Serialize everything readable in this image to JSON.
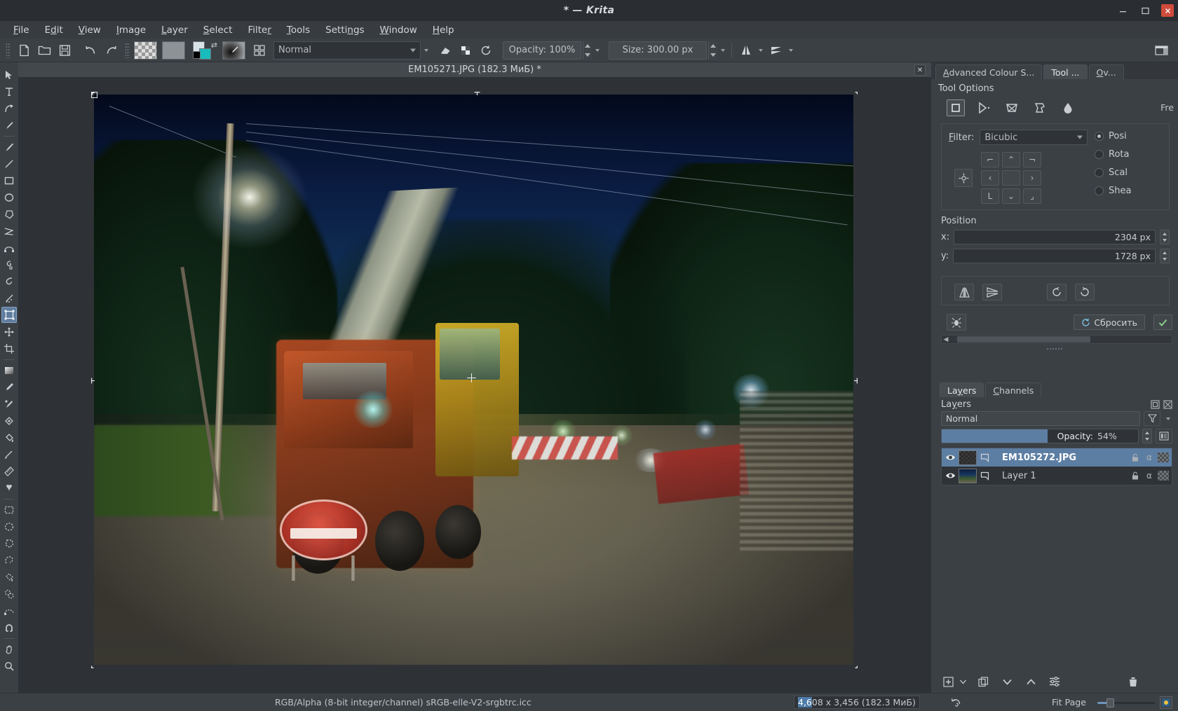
{
  "window": {
    "title": "* — Krita",
    "controls": {
      "minimize": "–",
      "maximize": "□",
      "close": "✕"
    }
  },
  "menubar": {
    "items": [
      {
        "label": "File",
        "accel": "F"
      },
      {
        "label": "Edit",
        "accel": "E"
      },
      {
        "label": "View",
        "accel": "V"
      },
      {
        "label": "Image",
        "accel": "I"
      },
      {
        "label": "Layer",
        "accel": "L"
      },
      {
        "label": "Select",
        "accel": "S"
      },
      {
        "label": "Filter",
        "accel": "r"
      },
      {
        "label": "Tools",
        "accel": "T"
      },
      {
        "label": "Settings",
        "accel": "n"
      },
      {
        "label": "Window",
        "accel": "W"
      },
      {
        "label": "Help",
        "accel": "H"
      }
    ]
  },
  "toolbar": {
    "new_label": "new-document",
    "open_label": "open-document",
    "save_label": "save-document",
    "undo_label": "undo",
    "redo_label": "redo",
    "gradient_label": "gradients",
    "pattern_label": "patterns",
    "fgbg_label": "foreground-background-colours",
    "brush_preset_label": "brush-presets",
    "brush_editor_label": "edit-brush-settings",
    "blending_mode": "Normal",
    "eraser_label": "eraser-mode",
    "alpha_label": "preserve-alpha",
    "reload_label": "reload-preset",
    "opacity": "Opacity: 100%",
    "size": "Size: 300.00 px",
    "mirror_h_label": "horizontal-mirror",
    "mirror_v_label": "vertical-mirror",
    "workspace_label": "choose-workspace"
  },
  "toolbox": {
    "tools": [
      {
        "name": "select-shapes-tool",
        "glyph": "cursor",
        "active": false
      },
      {
        "name": "text-tool",
        "glyph": "text",
        "active": false
      },
      {
        "name": "edit-shapes-tool",
        "glyph": "node",
        "active": false
      },
      {
        "name": "calligraphy-tool",
        "glyph": "calligraphy",
        "active": false
      },
      {
        "name": "freehand-brush-tool",
        "glyph": "brush",
        "active": false
      },
      {
        "name": "line-tool",
        "glyph": "line",
        "active": false
      },
      {
        "name": "rectangle-tool",
        "glyph": "rect",
        "active": false
      },
      {
        "name": "ellipse-tool",
        "glyph": "ellipse",
        "active": false
      },
      {
        "name": "polygon-tool",
        "glyph": "polygon",
        "active": false
      },
      {
        "name": "polyline-tool",
        "glyph": "polyline",
        "active": false
      },
      {
        "name": "bezier-curve-tool",
        "glyph": "bezier",
        "active": false
      },
      {
        "name": "freehand-path-tool",
        "glyph": "freehandpath",
        "active": false
      },
      {
        "name": "dynamic-brush-tool",
        "glyph": "dynbrush",
        "active": false
      },
      {
        "name": "multibrush-tool",
        "glyph": "multibrush",
        "active": false
      },
      {
        "name": "transform-tool",
        "glyph": "transform",
        "active": true
      },
      {
        "name": "move-tool",
        "glyph": "move",
        "active": false
      },
      {
        "name": "crop-tool",
        "glyph": "crop",
        "active": false
      },
      {
        "name": "gradient-tool",
        "glyph": "gradient",
        "active": false
      },
      {
        "name": "colour-sampler-tool",
        "glyph": "picker",
        "active": false
      },
      {
        "name": "colourize-mask-tool",
        "glyph": "colorize",
        "active": false
      },
      {
        "name": "smart-patch-tool",
        "glyph": "patch",
        "active": false
      },
      {
        "name": "fill-tool",
        "glyph": "fill",
        "active": false
      },
      {
        "name": "enclose-and-fill-tool",
        "glyph": "enclosefill",
        "active": false
      },
      {
        "name": "measure-tool",
        "glyph": "measure",
        "active": false
      },
      {
        "name": "reference-images-tool",
        "glyph": "reference",
        "active": false
      },
      {
        "name": "rectangular-selection-tool",
        "glyph": "selrect",
        "active": false
      },
      {
        "name": "elliptical-selection-tool",
        "glyph": "selellipse",
        "active": false
      },
      {
        "name": "polygonal-selection-tool",
        "glyph": "selpoly",
        "active": false
      },
      {
        "name": "freehand-selection-tool",
        "glyph": "sellasso",
        "active": false
      },
      {
        "name": "contiguous-selection-tool",
        "glyph": "selcontig",
        "active": false
      },
      {
        "name": "similar-colour-selection-tool",
        "glyph": "selsimilar",
        "active": false
      },
      {
        "name": "bezier-selection-tool",
        "glyph": "selbezier",
        "active": false
      },
      {
        "name": "magnetic-selection-tool",
        "glyph": "selmagnetic",
        "active": false
      },
      {
        "name": "pan-tool",
        "glyph": "pan",
        "active": false
      },
      {
        "name": "zoom-tool",
        "glyph": "zoom",
        "active": false
      }
    ]
  },
  "document": {
    "tab_title": "EM105271.JPG (182.3 МиБ) *",
    "close_label": "✕"
  },
  "right_dock": {
    "tabs": [
      {
        "label": "Advanced Colour S...",
        "accel": "A",
        "active": false
      },
      {
        "label": "Tool ...",
        "accel": "",
        "active": true
      },
      {
        "label": "Ov...",
        "accel": "O",
        "active": false
      }
    ],
    "tool_options": {
      "title": "Tool Options",
      "modes": [
        {
          "name": "free-transform-mode",
          "active": true
        },
        {
          "name": "perspective-transform-mode",
          "active": false
        },
        {
          "name": "warp-transform-mode",
          "active": false
        },
        {
          "name": "cage-transform-mode",
          "active": false
        },
        {
          "name": "liquify-transform-mode",
          "active": false
        }
      ],
      "mode_name": "Fre",
      "filter_label": "Filter:",
      "filter_value": "Bicubic",
      "anchor_label": "anchor-point-selector",
      "position_label": "Position",
      "x_label": "x:",
      "x_value": "2304 px",
      "y_label": "y:",
      "y_value": "1728 px",
      "radios": [
        {
          "label": "Posi",
          "on": true
        },
        {
          "label": "Rota",
          "on": false
        },
        {
          "label": "Scal",
          "on": false
        },
        {
          "label": "Shea",
          "on": false
        }
      ],
      "flip_h_label": "flip-horizontally",
      "flip_v_label": "flip-vertically",
      "rotate_ccw_label": "rotate-counter-clockwise",
      "rotate_cw_label": "rotate-clockwise",
      "bug_label": "recursive-transform",
      "reset_label": "Сбросить",
      "apply_label": "✓"
    },
    "layers_docker": {
      "tabs": [
        {
          "label": "Layers",
          "accel": "y",
          "active": true
        },
        {
          "label": "Channels",
          "accel": "C",
          "active": false
        }
      ],
      "title": "Layers",
      "float_label": "float-docker",
      "close_label": "close-docker",
      "blending_mode": "Normal",
      "filter_label": "layer-filter",
      "opacity_label": "Opacity:",
      "opacity_value": "54%",
      "opacity_percent": 54,
      "properties_label": "layer-properties",
      "layers": [
        {
          "name": "EM105272.JPG",
          "selected": true,
          "visible": true,
          "thumb": "checker",
          "locked": false,
          "alpha_locked": false
        },
        {
          "name": "Layer 1",
          "selected": false,
          "visible": true,
          "thumb": "photo",
          "locked": false,
          "alpha_locked": false
        }
      ],
      "bottom_buttons": [
        {
          "name": "add-layer-button",
          "glyph": "plus"
        },
        {
          "name": "add-layer-dropdown",
          "glyph": "caret"
        },
        {
          "name": "duplicate-layer-button",
          "glyph": "duplicate"
        },
        {
          "name": "move-layer-down-button",
          "glyph": "down"
        },
        {
          "name": "move-layer-up-button",
          "glyph": "up"
        },
        {
          "name": "layer-properties-button",
          "glyph": "sliders"
        },
        {
          "name": "delete-layer-button",
          "glyph": "trash"
        }
      ]
    }
  },
  "statusbar": {
    "colorspace": "RGB/Alpha (8-bit integer/channel)  sRGB-elle-V2-srgbtrc.icc",
    "image_size_highlight": "4,6",
    "image_size": "08 x 3,456 (182.3 МиБ)",
    "undo_label": "undo-history",
    "fit_label": "Fit Page",
    "zoom_icon_label": "zoom-reset"
  },
  "colors": {
    "accent": "#5d7ea3",
    "panel": "#3b4045",
    "panel_dark": "#2f3337",
    "titlebar": "#2a2e32",
    "text": "#c8cbcd",
    "close_red": "#d14b3c"
  }
}
